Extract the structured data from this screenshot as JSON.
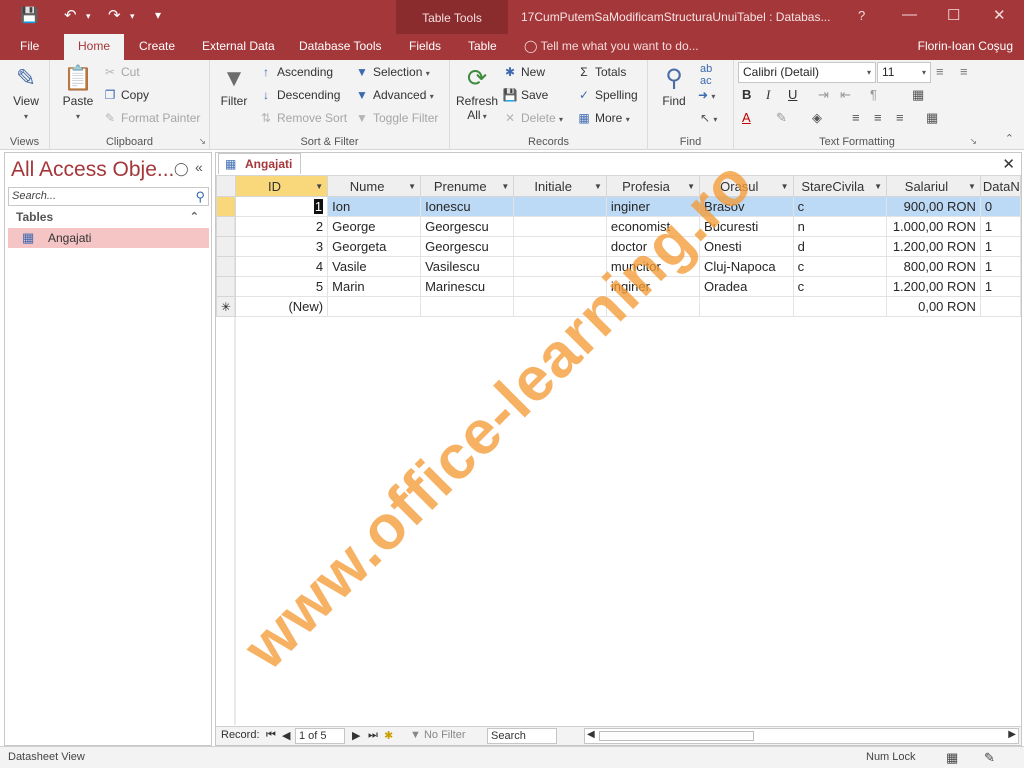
{
  "titlebar": {
    "table_tools": "Table Tools",
    "doc_title": "17CumPutemSaModificamStructuraUnuiTabel : Databas...",
    "help": "?",
    "save_icon": "save-icon",
    "undo_icon": "undo-icon",
    "redo_icon": "redo-icon"
  },
  "tabs": {
    "file": "File",
    "home": "Home",
    "create": "Create",
    "external_data": "External Data",
    "database_tools": "Database Tools",
    "fields": "Fields",
    "table": "Table",
    "tell_me": "Tell me what you want to do...",
    "user": "Florin-Ioan Coşug"
  },
  "ribbon": {
    "views": {
      "label": "Views",
      "view": "View"
    },
    "clipboard": {
      "label": "Clipboard",
      "paste": "Paste",
      "cut": "Cut",
      "copy": "Copy",
      "format_painter": "Format Painter"
    },
    "sort_filter": {
      "label": "Sort & Filter",
      "filter": "Filter",
      "ascending": "Ascending",
      "descending": "Descending",
      "remove_sort": "Remove Sort",
      "selection": "Selection",
      "advanced": "Advanced",
      "toggle_filter": "Toggle Filter"
    },
    "records": {
      "label": "Records",
      "refresh": "Refresh",
      "refresh_all": "All",
      "new": "New",
      "save": "Save",
      "delete": "Delete",
      "totals": "Totals",
      "spelling": "Spelling",
      "more": "More"
    },
    "find": {
      "label": "Find",
      "find": "Find"
    },
    "text_formatting": {
      "label": "Text Formatting",
      "font": "Calibri (Detail)",
      "size": "11"
    }
  },
  "navpane": {
    "title": "All Access Obje...",
    "search_placeholder": "Search...",
    "section": "Tables",
    "item": "Angajati"
  },
  "document": {
    "tab": "Angajati",
    "columns": [
      "ID",
      "Nume",
      "Prenume",
      "Initiale",
      "Profesia",
      "Orasul",
      "StareCivila",
      "Salariul",
      "DataN"
    ],
    "rows": [
      [
        "1",
        "Ion",
        "Ionescu",
        "",
        "inginer",
        "Brasov",
        "c",
        "900,00 RON",
        "0"
      ],
      [
        "2",
        "George",
        "Georgescu",
        "",
        "economist",
        "Bucuresti",
        "n",
        "1.000,00 RON",
        "1"
      ],
      [
        "3",
        "Georgeta",
        "Georgescu",
        "",
        "doctor",
        "Onesti",
        "d",
        "1.200,00 RON",
        "1"
      ],
      [
        "4",
        "Vasile",
        "Vasilescu",
        "",
        "muncitor",
        "Cluj-Napoca",
        "c",
        "800,00 RON",
        "1"
      ],
      [
        "5",
        "Marin",
        "Marinescu",
        "",
        "inginer",
        "Oradea",
        "c",
        "1.200,00 RON",
        "1"
      ]
    ],
    "new_row": {
      "id": "(New)",
      "salariul": "0,00 RON"
    }
  },
  "record_nav": {
    "label": "Record:",
    "position": "1 of 5",
    "filter": "No Filter",
    "search": "Search"
  },
  "status": {
    "view": "Datasheet View",
    "num_lock": "Num Lock"
  },
  "watermark": "www.office-learning.ro",
  "colors": {
    "accent": "#a4373a",
    "selected_row": "#bcd9f5",
    "id_header": "#f9d77b",
    "nav_item": "#f5c4c5"
  }
}
